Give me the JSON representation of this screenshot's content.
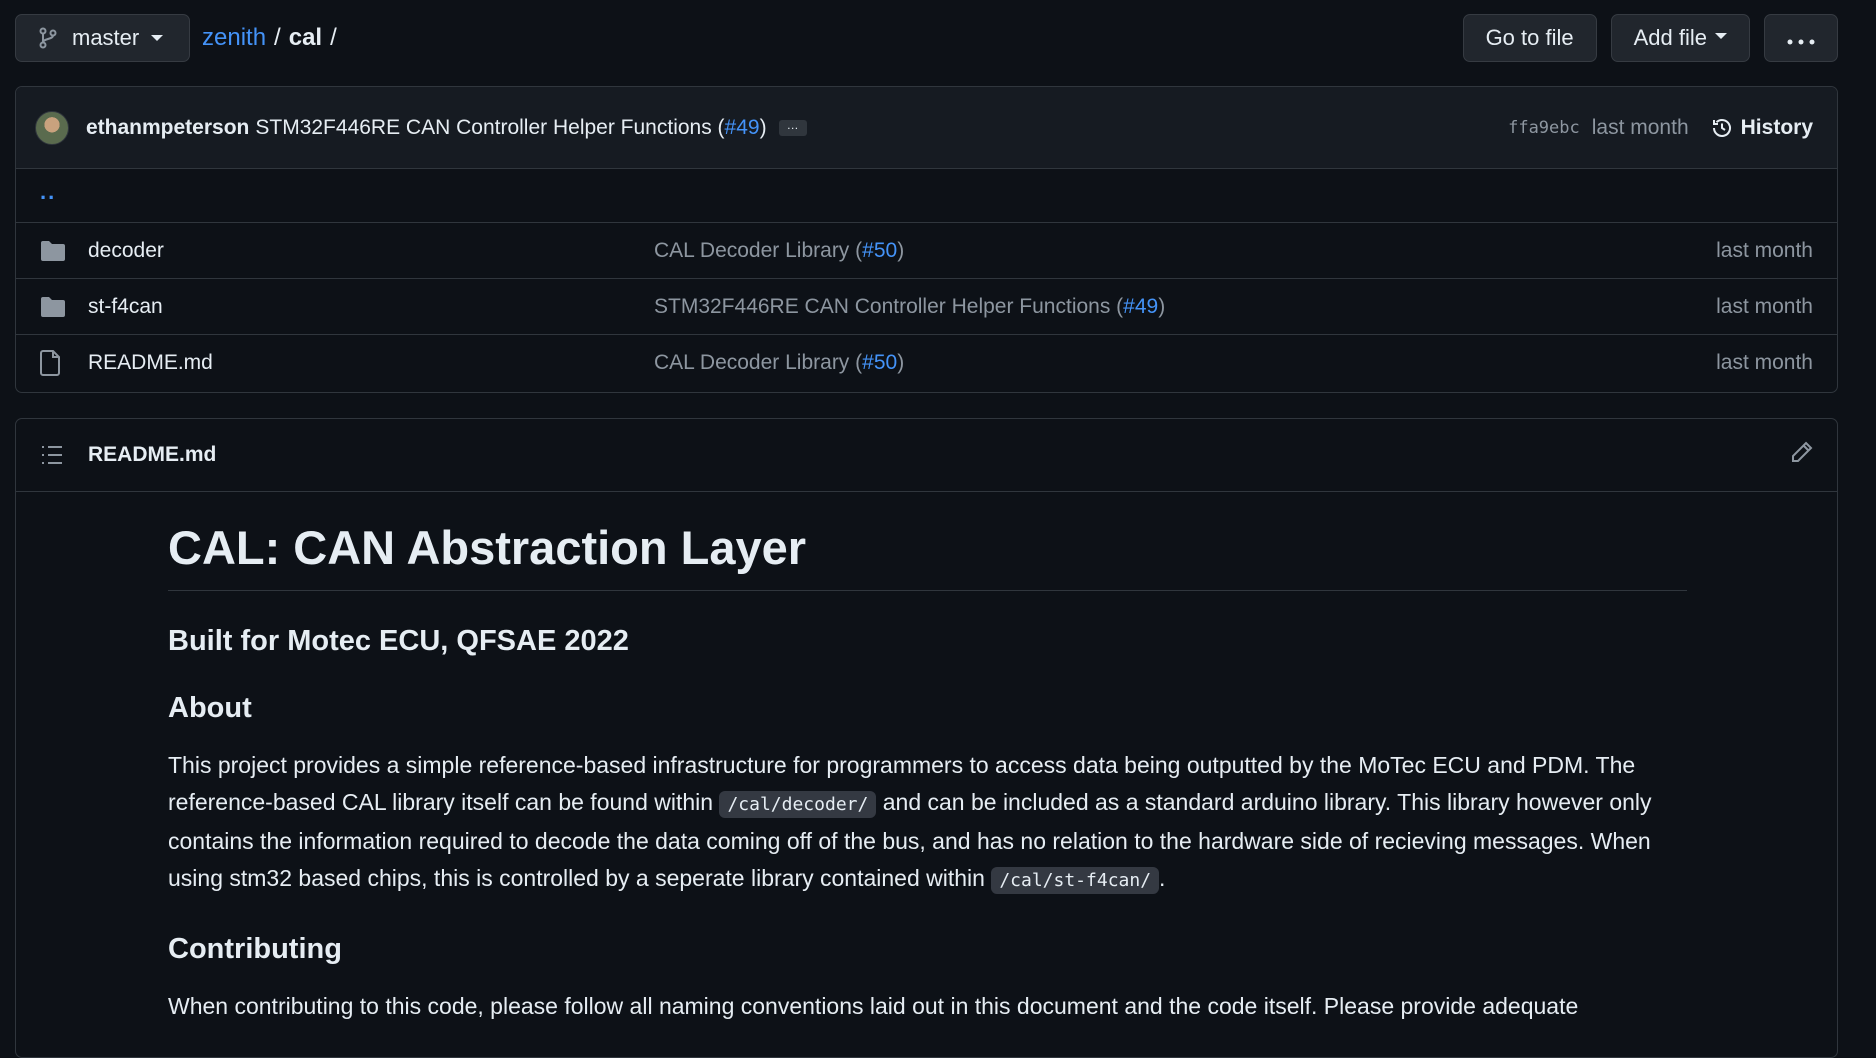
{
  "topbar": {
    "branch": "master",
    "breadcrumb": {
      "repo": "zenith",
      "sep1": "/",
      "dir": "cal",
      "sep2": "/"
    },
    "goto_file": "Go to file",
    "add_file": "Add file",
    "more": "···"
  },
  "commit": {
    "author": "ethanmpeterson",
    "message_prefix": "STM32F446RE CAN Controller Helper Functions (",
    "pr": "#49",
    "message_suffix": ")",
    "ellipsis": "…",
    "hash": "ffa9ebc",
    "time": "last month",
    "history": "History"
  },
  "parent_dir": "..",
  "files": [
    {
      "type": "folder",
      "name": "decoder",
      "msg_prefix": "CAL Decoder Library (",
      "pr": "#50",
      "msg_suffix": ")",
      "time": "last month"
    },
    {
      "type": "folder",
      "name": "st-f4can",
      "msg_prefix": "STM32F446RE CAN Controller Helper Functions (",
      "pr": "#49",
      "msg_suffix": ")",
      "time": "last month"
    },
    {
      "type": "file",
      "name": "README.md",
      "msg_prefix": "CAL Decoder Library (",
      "pr": "#50",
      "msg_suffix": ")",
      "time": "last month"
    }
  ],
  "readme": {
    "filename": "README.md",
    "h1": "CAL: CAN Abstraction Layer",
    "subtitle": "Built for Motec ECU, QFSAE 2022",
    "about_heading": "About",
    "about_p1": "This project provides a simple reference-based infrastructure for programmers to access data being outputted by the MoTec ECU and PDM. The reference-based CAL library itself can be found within ",
    "about_code1": "/cal/decoder/",
    "about_p2": " and can be included as a standard arduino library. This library however only contains the information required to decode the data coming off of the bus, and has no relation to the hardware side of recieving messages. When using stm32 based chips, this is controlled by a seperate library contained within ",
    "about_code2": "/cal/st-f4can/",
    "about_p3": ".",
    "contrib_heading": "Contributing",
    "contrib_p": "When contributing to this code, please follow all naming conventions laid out in this document and the code itself. Please provide adequate"
  },
  "colors": {
    "background": "#0d1117",
    "accent_link": "#4493f8",
    "muted_text": "#8d96a0",
    "border": "#30363d"
  }
}
